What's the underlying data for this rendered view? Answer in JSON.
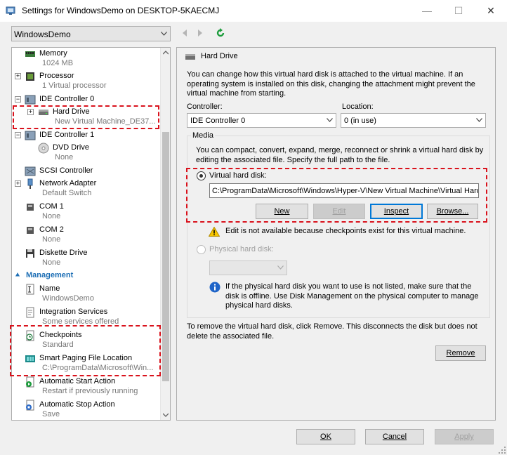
{
  "window": {
    "title": "Settings for WindowsDemo on DESKTOP-5KAECMJ",
    "minimize": "—",
    "maximize": "☐",
    "close": "✕"
  },
  "toolbar": {
    "vm_selected": "WindowsDemo",
    "back_icon": "left-arrow-icon",
    "forward_icon": "right-arrow-icon",
    "refresh_icon": "refresh-icon"
  },
  "tree": {
    "memory": {
      "label": "Memory",
      "sub": "1024 MB"
    },
    "processor": {
      "label": "Processor",
      "sub": "1 Virtual processor"
    },
    "ide0": {
      "label": "IDE Controller 0"
    },
    "harddrive": {
      "label": "Hard Drive",
      "sub": "New Virtual Machine_DE37..."
    },
    "ide1": {
      "label": "IDE Controller 1"
    },
    "dvd": {
      "label": "DVD Drive",
      "sub": "None"
    },
    "scsi": {
      "label": "SCSI Controller"
    },
    "network": {
      "label": "Network Adapter",
      "sub": "Default Switch"
    },
    "com1": {
      "label": "COM 1",
      "sub": "None"
    },
    "com2": {
      "label": "COM 2",
      "sub": "None"
    },
    "diskette": {
      "label": "Diskette Drive",
      "sub": "None"
    },
    "management": "Management",
    "name": {
      "label": "Name",
      "sub": "WindowsDemo"
    },
    "integration": {
      "label": "Integration Services",
      "sub": "Some services offered"
    },
    "checkpoints": {
      "label": "Checkpoints",
      "sub": "Standard"
    },
    "paging": {
      "label": "Smart Paging File Location",
      "sub": "C:\\ProgramData\\Microsoft\\Win..."
    },
    "autostart": {
      "label": "Automatic Start Action",
      "sub": "Restart if previously running"
    },
    "autostop": {
      "label": "Automatic Stop Action",
      "sub": "Save"
    }
  },
  "panel": {
    "title": "Hard Drive",
    "description": "You can change how this virtual hard disk is attached to the virtual machine. If an operating system is installed on this disk, changing the attachment might prevent the virtual machine from starting.",
    "controller_label": "Controller:",
    "controller_value": "IDE Controller 0",
    "location_label": "Location:",
    "location_value": "0 (in use)",
    "media_title": "Media",
    "media_desc": "You can compact, convert, expand, merge, reconnect or shrink a virtual hard disk by editing the associated file. Specify the full path to the file.",
    "vhd_label": "Virtual hard disk:",
    "vhd_path": "C:\\ProgramData\\Microsoft\\Windows\\Hyper-V\\New Virtual Machine\\Virtual Hard",
    "btn_new": "New",
    "btn_edit": "Edit",
    "btn_inspect": "Inspect",
    "btn_browse": "Browse...",
    "warning_text": "Edit is not available because checkpoints exist for this virtual machine.",
    "phys_label": "Physical hard disk:",
    "phys_info": "If the physical hard disk you want to use is not listed, make sure that the disk is offline. Use Disk Management on the physical computer to manage physical hard disks.",
    "remove_desc": "To remove the virtual hard disk, click Remove. This disconnects the disk but does not delete the associated file.",
    "btn_remove": "Remove"
  },
  "footer": {
    "ok": "OK",
    "cancel": "Cancel",
    "apply": "Apply"
  },
  "colors": {
    "accent": "#0078d7",
    "highlight_red": "#d9121c",
    "management_blue": "#1e6fb5"
  }
}
